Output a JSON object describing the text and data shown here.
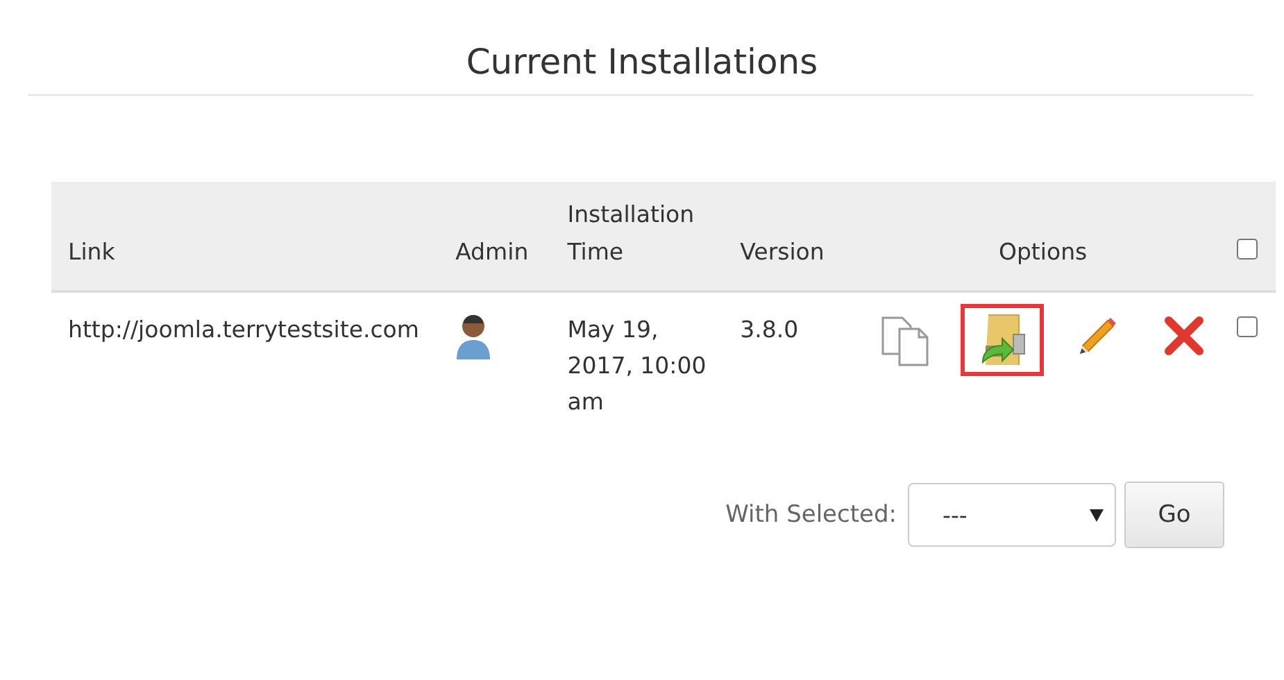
{
  "page_title": "Current Installations",
  "table": {
    "columns": [
      {
        "label": "Link"
      },
      {
        "label": "Admin"
      },
      {
        "label": "Installation Time"
      },
      {
        "label": "Version"
      },
      {
        "label": "Options"
      }
    ],
    "select_all": {
      "checked": false
    },
    "rows": [
      {
        "link": "http://joomla.terrytestsite.com",
        "installation_time": "May 19, 2017, 10:00 am",
        "version": "3.8.0",
        "checked": false,
        "options": [
          {
            "kind": "clone",
            "highlighted": false
          },
          {
            "kind": "backup",
            "highlighted": true
          },
          {
            "kind": "edit",
            "highlighted": false
          },
          {
            "kind": "remove",
            "highlighted": false
          }
        ]
      }
    ]
  },
  "bulk_action": {
    "label": "With Selected:",
    "value": "---",
    "button": "Go"
  }
}
